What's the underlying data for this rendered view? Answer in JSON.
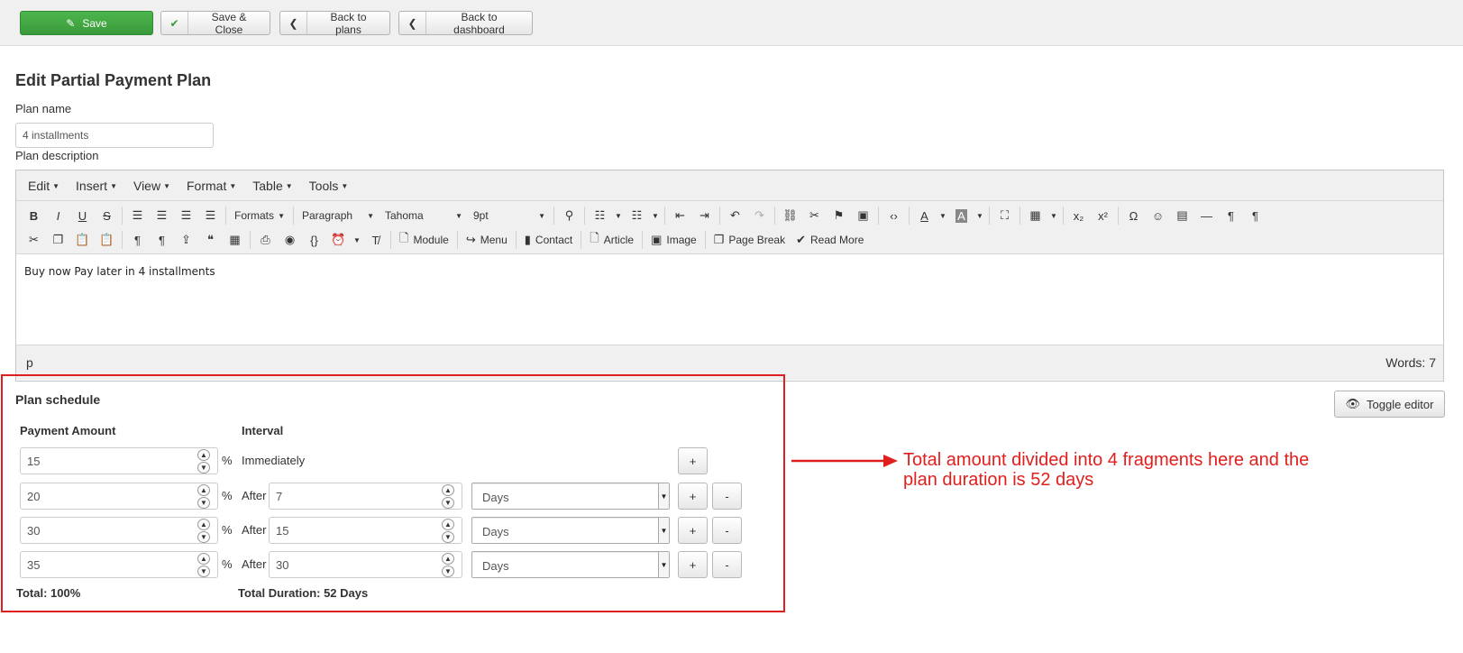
{
  "toolbar": {
    "save": "Save",
    "save_close": "Save & Close",
    "back_plans": "Back to plans",
    "back_dashboard": "Back to dashboard"
  },
  "form": {
    "title": "Edit Partial Payment Plan",
    "plan_name_label": "Plan name",
    "plan_name_value": "4 installments",
    "plan_description_label": "Plan description"
  },
  "editor": {
    "menus": [
      "Edit",
      "Insert",
      "View",
      "Format",
      "Table",
      "Tools"
    ],
    "formats_dropdown": "Formats",
    "block_dropdown": "Paragraph",
    "font_dropdown": "Tahoma",
    "size_dropdown": "9pt",
    "buttons_row2": {
      "module": "Module",
      "menu": "Menu",
      "contact": "Contact",
      "article": "Article",
      "image": "Image",
      "page_break": "Page Break",
      "read_more": "Read More"
    },
    "content": "Buy now Pay later in 4 installments",
    "path": "p",
    "word_count": "Words: 7",
    "toggle_editor": "Toggle editor"
  },
  "schedule": {
    "title": "Plan schedule",
    "col_amount": "Payment Amount",
    "col_interval": "Interval",
    "percent_symbol": "%",
    "immediately": "Immediately",
    "after_label": "After",
    "add_symbol": "+",
    "remove_symbol": "-",
    "rows": [
      {
        "amount": "15"
      },
      {
        "amount": "20",
        "interval": "7",
        "unit": "Days"
      },
      {
        "amount": "30",
        "interval": "15",
        "unit": "Days"
      },
      {
        "amount": "35",
        "interval": "30",
        "unit": "Days"
      }
    ],
    "total": "Total: 100%",
    "total_duration": "Total Duration: 52 Days"
  },
  "annotation": {
    "line1": "Total amount divided into 4 fragments here and the",
    "line2": "plan duration is 52 days",
    "color": "#e0201e"
  },
  "colors": {
    "save_green": "#3fa63f",
    "annotation_red": "#e0201e"
  }
}
